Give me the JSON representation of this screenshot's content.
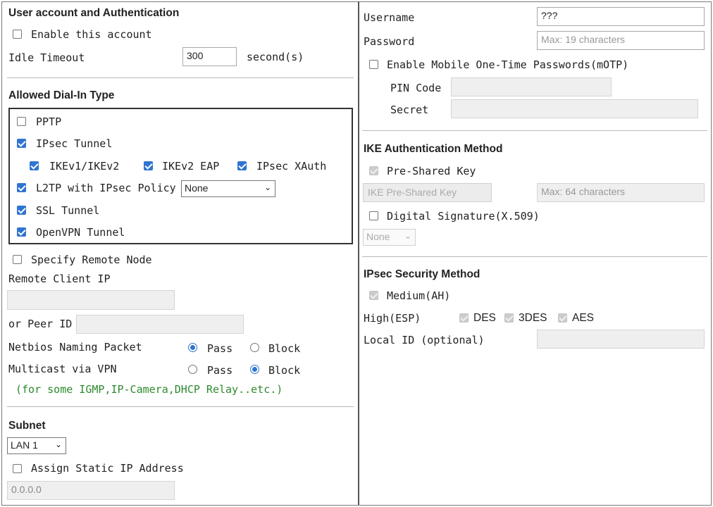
{
  "left": {
    "user_section": {
      "title": "User account and Authentication",
      "enable_account_label": "Enable this account",
      "enable_account_checked": false,
      "idle_timeout_label": "Idle Timeout",
      "idle_timeout_value": "300",
      "idle_timeout_unit": "second(s)"
    },
    "dialin": {
      "title": "Allowed Dial-In Type",
      "pptp": {
        "label": "PPTP",
        "checked": false
      },
      "ipsec_tunnel": {
        "label": "IPsec Tunnel",
        "checked": true
      },
      "ikev1": {
        "label": "IKEv1/IKEv2",
        "checked": true
      },
      "ikev2eap": {
        "label": "IKEv2 EAP",
        "checked": true
      },
      "xauth": {
        "label": "IPsec XAuth",
        "checked": true
      },
      "l2tp": {
        "label": "L2TP with IPsec Policy",
        "checked": true,
        "policy_value": "None"
      },
      "ssl": {
        "label": "SSL Tunnel",
        "checked": true
      },
      "openvpn": {
        "label": "OpenVPN Tunnel",
        "checked": true
      }
    },
    "remote": {
      "specify_label": "Specify Remote Node",
      "specify_checked": false,
      "client_ip_label": "Remote Client IP",
      "client_ip_value": "",
      "peer_id_label": "or Peer ID",
      "peer_id_value": "",
      "netbios_label": "Netbios Naming Packet",
      "netbios_pass": "Pass",
      "netbios_block": "Block",
      "netbios_selected": "Pass",
      "multicast_label": "Multicast via VPN",
      "multicast_pass": "Pass",
      "multicast_block": "Block",
      "multicast_selected": "Block",
      "note": "(for some IGMP,IP-Camera,DHCP Relay..etc.)"
    },
    "subnet": {
      "title": "Subnet",
      "lan_value": "LAN 1",
      "assign_static_label": "Assign Static IP Address",
      "assign_static_checked": false,
      "static_ip_value": "0.0.0.0"
    }
  },
  "right": {
    "username_label": "Username",
    "username_value": "???",
    "password_label": "Password",
    "password_placeholder": "Max: 19 characters",
    "motp_label": "Enable Mobile One-Time Passwords(mOTP)",
    "motp_checked": false,
    "pin_label": "PIN Code",
    "secret_label": "Secret",
    "ike": {
      "title": "IKE Authentication Method",
      "psk_label": "Pre-Shared Key",
      "psk_button": "IKE Pre-Shared Key",
      "psk_placeholder": "Max: 64 characters",
      "digital_sig_label": "Digital Signature(X.509)",
      "digital_sig_checked": false,
      "cert_value": "None"
    },
    "ipsec": {
      "title": "IPsec Security Method",
      "medium_label": "Medium(AH)",
      "high_label": "High(ESP)",
      "des_label": "DES",
      "tdes_label": "3DES",
      "aes_label": "AES",
      "local_id_label": "Local ID (optional)",
      "local_id_value": ""
    }
  },
  "colors": {
    "check_blue": "#2f74d0",
    "note_green": "#2c8a2c",
    "border_dark": "#333333"
  }
}
